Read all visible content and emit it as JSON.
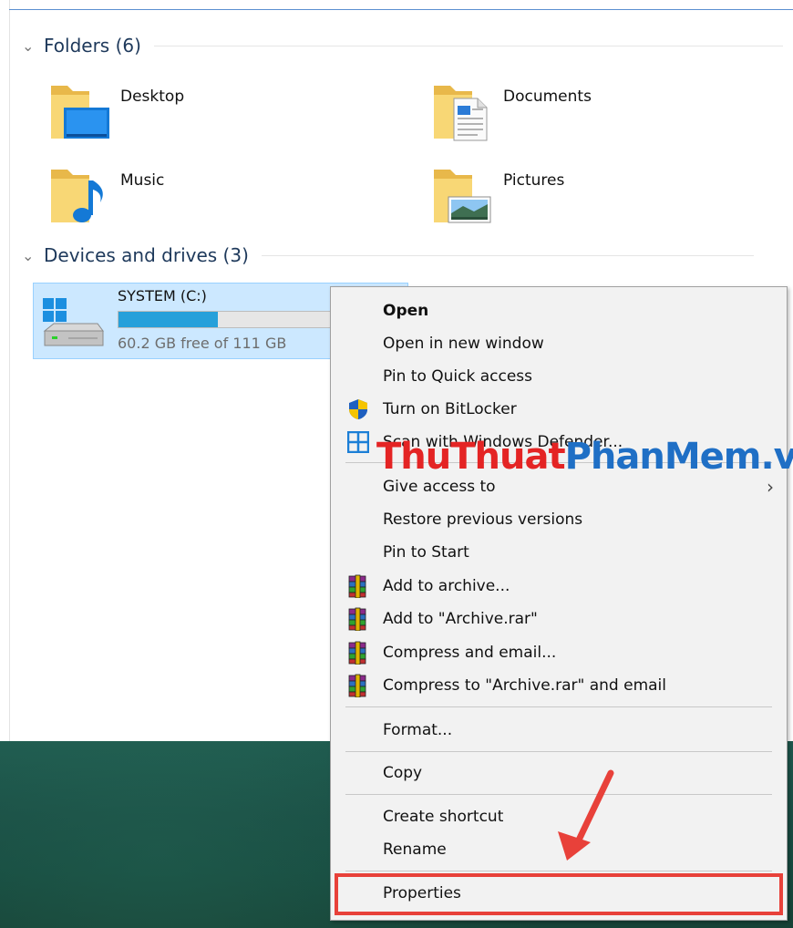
{
  "explorer": {
    "groups": [
      {
        "label": "Folders (6)"
      },
      {
        "label": "Devices and drives (3)"
      }
    ],
    "folders": [
      {
        "name": "Desktop"
      },
      {
        "name": "Documents"
      },
      {
        "name": "Music"
      },
      {
        "name": "Pictures"
      }
    ],
    "drive": {
      "name": "SYSTEM (C:)",
      "free_text": "60.2 GB free of 111 GB",
      "used_fraction": 0.458
    }
  },
  "context_menu": {
    "items": [
      {
        "label": "Open",
        "bold": true,
        "icon": ""
      },
      {
        "label": "Open in new window",
        "icon": ""
      },
      {
        "label": "Pin to Quick access",
        "icon": ""
      },
      {
        "label": "Turn on BitLocker",
        "icon": "uac-shield-icon"
      },
      {
        "label": "Scan with Windows Defender...",
        "icon": "defender-icon"
      },
      {
        "label": "Give access to",
        "icon": "",
        "submenu": true
      },
      {
        "label": "Restore previous versions",
        "icon": ""
      },
      {
        "label": "Pin to Start",
        "icon": ""
      },
      {
        "label": "Add to archive...",
        "icon": "winrar-icon"
      },
      {
        "label": "Add to \"Archive.rar\"",
        "icon": "winrar-icon"
      },
      {
        "label": "Compress and email...",
        "icon": "winrar-icon"
      },
      {
        "label": "Compress to \"Archive.rar\" and email",
        "icon": "winrar-icon"
      },
      {
        "label": "Format...",
        "icon": ""
      },
      {
        "label": "Copy",
        "icon": ""
      },
      {
        "label": "Create shortcut",
        "icon": ""
      },
      {
        "label": "Rename",
        "icon": ""
      },
      {
        "label": "Properties",
        "icon": ""
      }
    ],
    "submenu_arrow": "›"
  },
  "watermark": {
    "part1": "ThuThuat",
    "part2": "PhanMem",
    "part3": ".vn"
  },
  "colors": {
    "highlight": "#e8413a",
    "accent": "#26a0da",
    "selection": "#cce8ff"
  }
}
